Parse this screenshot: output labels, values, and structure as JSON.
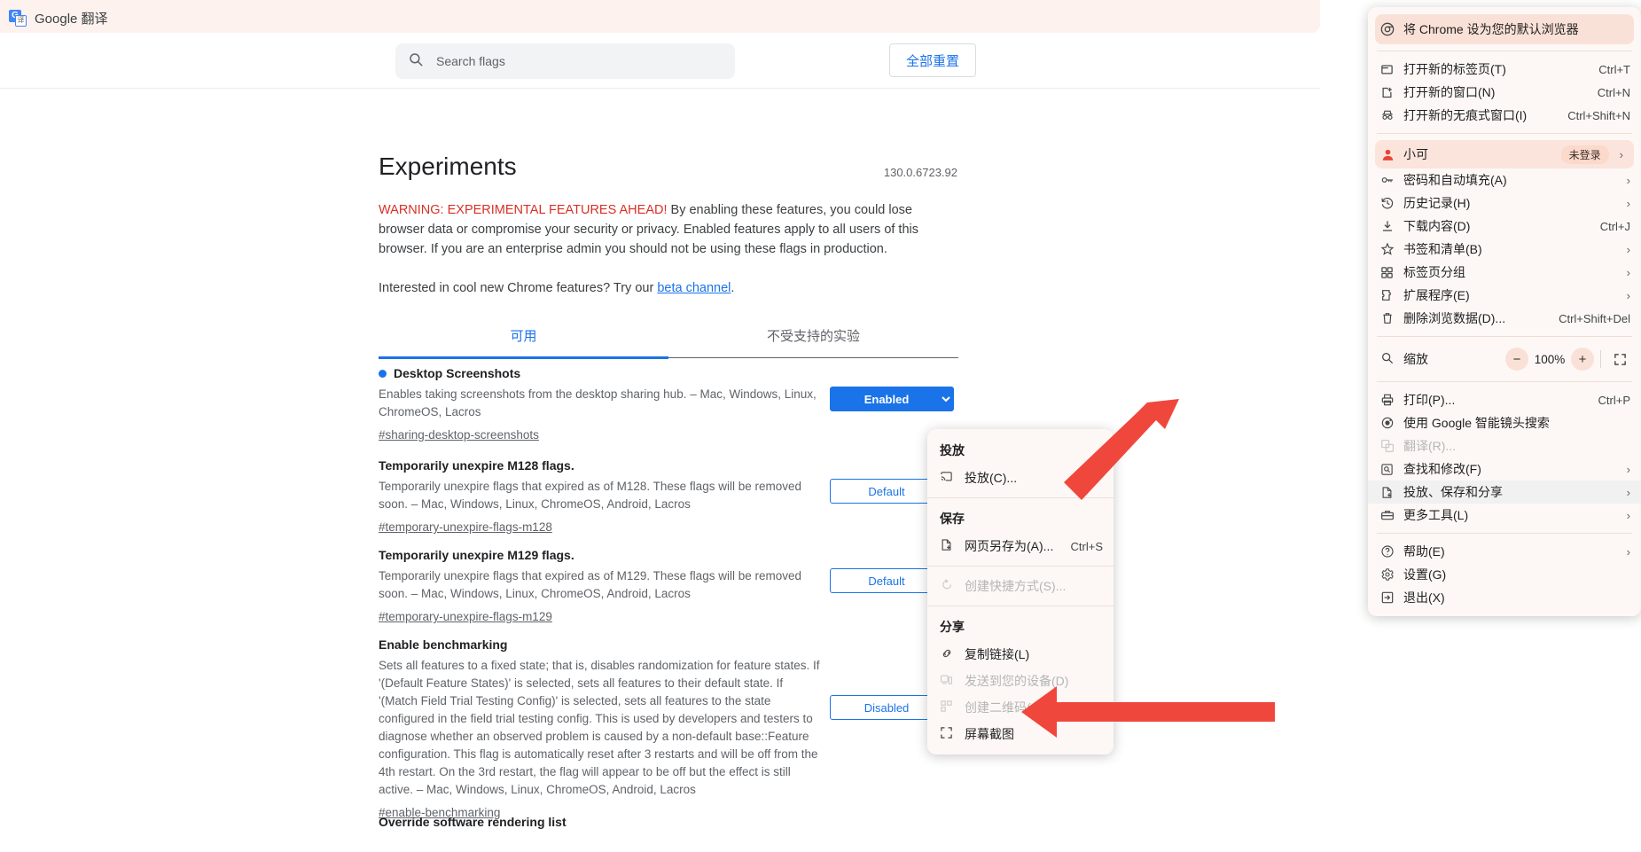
{
  "translate_bar": {
    "label": "Google 翻译",
    "icon": "google-translate-icon"
  },
  "flags_toolbar": {
    "search_placeholder": "Search flags",
    "search_value": "",
    "search_icon": "search-icon",
    "reset_all_label": "全部重置"
  },
  "flags_page": {
    "title": "Experiments",
    "version": "130.0.6723.92",
    "warning_strong": "WARNING: EXPERIMENTAL FEATURES AHEAD!",
    "warning_rest": " By enabling these features, you could lose browser data or compromise your security or privacy. Enabled features apply to all users of this browser. If you are an enterprise admin you should not be using these flags in production.",
    "beta_prefix": "Interested in cool new Chrome features? Try our ",
    "beta_link": "beta channel",
    "beta_suffix": ".",
    "tabs": [
      {
        "label": "可用",
        "active": true
      },
      {
        "label": "不受支持的实验",
        "active": false
      }
    ],
    "flags": [
      {
        "name": "Desktop Screenshots",
        "description": "Enables taking screenshots from the desktop sharing hub. – Mac, Windows, Linux, ChromeOS, Lacros",
        "anchor": "#sharing-desktop-screenshots",
        "value": "Enabled",
        "state": "enabled",
        "modified": true
      },
      {
        "name": "Temporarily unexpire M128 flags.",
        "description": "Temporarily unexpire flags that expired as of M128. These flags will be removed soon. – Mac, Windows, Linux, ChromeOS, Android, Lacros",
        "anchor": "#temporary-unexpire-flags-m128",
        "value": "Default",
        "state": "default",
        "modified": false
      },
      {
        "name": "Temporarily unexpire M129 flags.",
        "description": "Temporarily unexpire flags that expired as of M129. These flags will be removed soon. – Mac, Windows, Linux, ChromeOS, Android, Lacros",
        "anchor": "#temporary-unexpire-flags-m129",
        "value": "Default",
        "state": "default",
        "modified": false
      },
      {
        "name": "Enable benchmarking",
        "description": "Sets all features to a fixed state; that is, disables randomization for feature states. If '(Default Feature States)' is selected, sets all features to their default state. If '(Match Field Trial Testing Config)' is selected, sets all features to the state configured in the field trial testing config. This is used by developers and testers to diagnose whether an observed problem is caused by a non-default base::Feature configuration. This flag is automatically reset after 3 restarts and will be off from the 4th restart. On the 3rd restart, the flag will appear to be off but the effect is still active. – Mac, Windows, Linux, ChromeOS, Android, Lacros",
        "anchor": "#enable-benchmarking",
        "value": "Disabled",
        "state": "disabled",
        "modified": false
      },
      {
        "name": "Override software rendering list",
        "description": "",
        "anchor": "",
        "value": "",
        "state": "default",
        "modified": false
      }
    ]
  },
  "chrome_menu": {
    "default_browser": {
      "label": "将 Chrome 设为您的默认浏览器",
      "icon": "chrome-logo-icon"
    },
    "group1": [
      {
        "label": "打开新的标签页(T)",
        "accel": "Ctrl+T",
        "icon": "new-tab-icon"
      },
      {
        "label": "打开新的窗口(N)",
        "accel": "Ctrl+N",
        "icon": "new-window-icon"
      },
      {
        "label": "打开新的无痕式窗口(I)",
        "accel": "Ctrl+Shift+N",
        "icon": "incognito-icon"
      }
    ],
    "profile": {
      "label": "小可",
      "badge": "未登录",
      "icon": "person-icon",
      "arrow": "›"
    },
    "group2": [
      {
        "label": "密码和自动填充(A)",
        "accel": "",
        "arrow": "›",
        "icon": "key-icon"
      },
      {
        "label": "历史记录(H)",
        "accel": "",
        "arrow": "›",
        "icon": "history-icon"
      },
      {
        "label": "下载内容(D)",
        "accel": "Ctrl+J",
        "arrow": "",
        "icon": "download-icon"
      },
      {
        "label": "书签和清单(B)",
        "accel": "",
        "arrow": "›",
        "icon": "star-icon"
      },
      {
        "label": "标签页分组",
        "accel": "",
        "arrow": "›",
        "icon": "tab-group-icon"
      },
      {
        "label": "扩展程序(E)",
        "accel": "",
        "arrow": "›",
        "icon": "puzzle-icon"
      },
      {
        "label": "删除浏览数据(D)...",
        "accel": "Ctrl+Shift+Del",
        "arrow": "",
        "icon": "trash-icon"
      }
    ],
    "zoom": {
      "label": "缩放",
      "icon": "zoom-icon",
      "minus": "−",
      "value": "100%",
      "plus": "+",
      "fullscreen_icon": "fullscreen-icon"
    },
    "group3": [
      {
        "label": "打印(P)...",
        "accel": "Ctrl+P",
        "arrow": "",
        "icon": "printer-icon",
        "disabled": false
      },
      {
        "label": "使用 Google 智能镜头搜索",
        "accel": "",
        "arrow": "",
        "icon": "lens-icon",
        "disabled": false
      },
      {
        "label": "翻译(R)...",
        "accel": "",
        "arrow": "",
        "icon": "translate-icon",
        "disabled": true
      },
      {
        "label": "查找和修改(F)",
        "accel": "",
        "arrow": "›",
        "icon": "find-icon",
        "disabled": false
      },
      {
        "label": "投放、保存和分享",
        "accel": "",
        "arrow": "›",
        "icon": "cast-save-share-icon",
        "disabled": false,
        "selected": true
      },
      {
        "label": "更多工具(L)",
        "accel": "",
        "arrow": "›",
        "icon": "toolbox-icon",
        "disabled": false
      }
    ],
    "group4": [
      {
        "label": "帮助(E)",
        "accel": "",
        "arrow": "›",
        "icon": "help-icon"
      },
      {
        "label": "设置(G)",
        "accel": "",
        "arrow": "",
        "icon": "gear-icon"
      },
      {
        "label": "退出(X)",
        "accel": "",
        "arrow": "",
        "icon": "exit-icon"
      }
    ]
  },
  "submenu": {
    "sections": [
      {
        "header": "投放",
        "items": [
          {
            "label": "投放(C)...",
            "accel": "",
            "icon": "cast-icon",
            "disabled": false
          }
        ]
      },
      {
        "header": "保存",
        "items": [
          {
            "label": "网页另存为(A)...",
            "accel": "Ctrl+S",
            "icon": "save-page-icon",
            "disabled": false
          },
          {
            "label": "创建快捷方式(S)...",
            "accel": "",
            "icon": "shortcut-icon",
            "disabled": true
          }
        ]
      },
      {
        "header": "分享",
        "items": [
          {
            "label": "复制链接(L)",
            "accel": "",
            "icon": "link-icon",
            "disabled": false
          },
          {
            "label": "发送到您的设备(D)",
            "accel": "",
            "icon": "devices-icon",
            "disabled": true
          },
          {
            "label": "创建二维码(Q)",
            "accel": "",
            "icon": "qr-code-icon",
            "disabled": true
          },
          {
            "label": "屏幕截图",
            "accel": "",
            "icon": "screenshot-icon",
            "disabled": false
          }
        ]
      }
    ]
  },
  "annotations": {
    "arrow_color": "#f0473c",
    "arrows": [
      {
        "name": "pointer-arrow-to-cast-save-share"
      },
      {
        "name": "pointer-arrow-to-screenshot"
      }
    ]
  }
}
